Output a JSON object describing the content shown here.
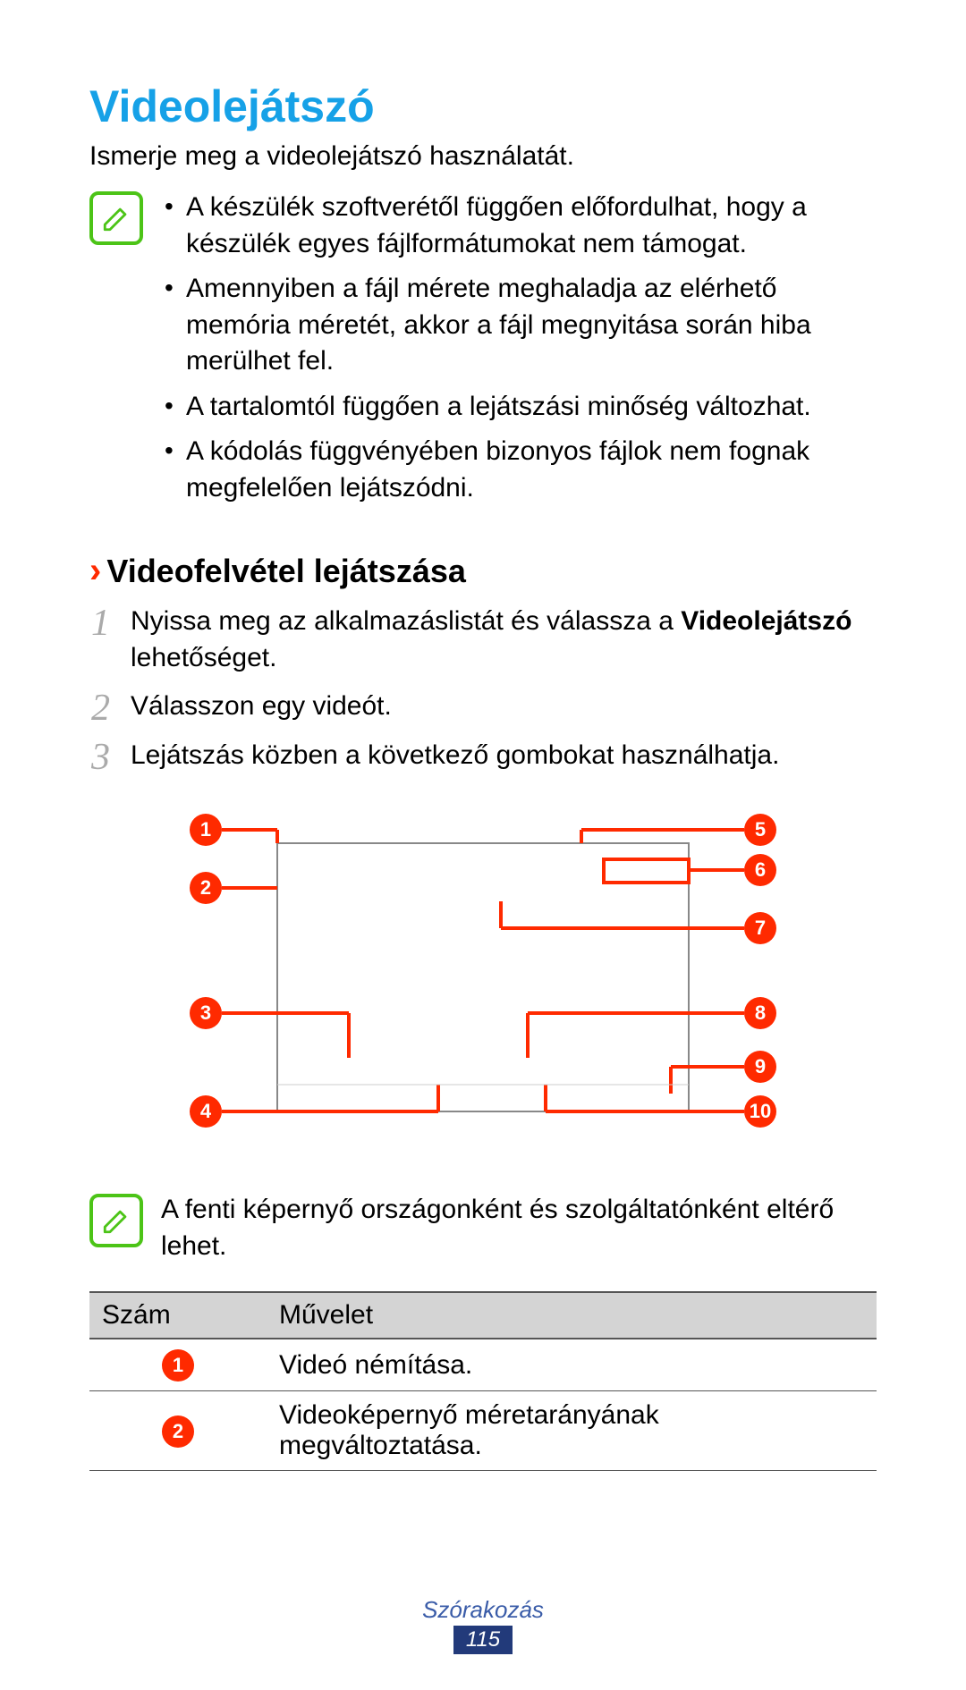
{
  "title": "Videolejátszó",
  "intro": "Ismerje meg a videolejátszó használatát.",
  "note1_bullets": [
    "A készülék szoftverétől függően előfordulhat, hogy a készülék egyes fájlformátumokat nem támogat.",
    "Amennyiben a fájl mérete meghaladja az elérhető memória méretét, akkor a fájl megnyitása során hiba merülhet fel.",
    "A tartalomtól függően a lejátszási minőség változhat.",
    "A kódolás függvényében bizonyos fájlok nem fognak megfelelően lejátszódni."
  ],
  "subheading": "Videofelvétel lejátszása",
  "steps": {
    "s1_pre": "Nyissa meg az alkalmazáslistát és válassza a ",
    "s1_bold": "Videolejátszó",
    "s1_post": " lehetőséget.",
    "s2": "Válasszon egy videót.",
    "s3": "Lejátszás közben a következő gombokat használhatja."
  },
  "callouts": [
    "1",
    "2",
    "3",
    "4",
    "5",
    "6",
    "7",
    "8",
    "9",
    "10"
  ],
  "note2": "A fenti képernyő országonként és szolgáltatónként eltérő lehet.",
  "table": {
    "h1": "Szám",
    "h2": "Művelet",
    "rows": [
      {
        "num": "1",
        "text": "Videó némítása."
      },
      {
        "num": "2",
        "text": "Videoképernyő méretarányának megváltoztatása."
      }
    ]
  },
  "footerCategory": "Szórakozás",
  "pageNumber": "115"
}
